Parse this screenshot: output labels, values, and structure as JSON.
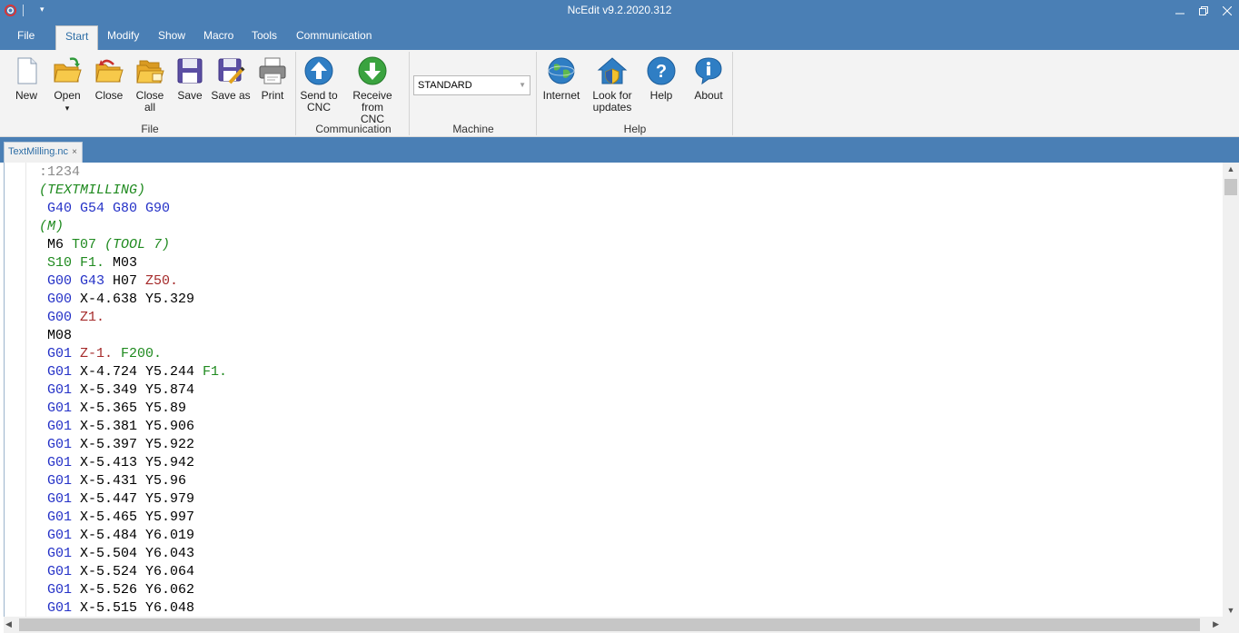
{
  "window": {
    "title": "NcEdit v9.2.2020.312",
    "qa_arrow": "▾",
    "minimize": "minimize",
    "restore": "restore",
    "close": "close"
  },
  "menu": {
    "tabs": [
      "File",
      "Start",
      "Modify",
      "Show",
      "Macro",
      "Tools",
      "Communication"
    ],
    "active": "Start"
  },
  "ribbon": {
    "file_group": {
      "label": "File",
      "buttons": {
        "new": "New",
        "open": "Open",
        "open_arrow": "▾",
        "close": "Close",
        "close_all": "Close all",
        "save": "Save",
        "save_as": "Save as",
        "print": "Print"
      }
    },
    "communication_group": {
      "label": "Communication",
      "send_line1": "Send to",
      "send_line2": "CNC",
      "receive_line1": "Receive from",
      "receive_line2": "CNC"
    },
    "machine_group": {
      "label": "Machine",
      "selected": "STANDARD"
    },
    "help_group": {
      "label": "Help",
      "internet": "Internet",
      "updates_line1": "Look for",
      "updates_line2": "updates",
      "help": "Help",
      "about": "About"
    }
  },
  "document": {
    "tab_name": "TextMilling.nc",
    "tab_close": "×"
  },
  "code_lines": [
    [
      {
        "t": ":1234",
        "k": "n"
      }
    ],
    [
      {
        "t": "(TEXTMILLING)",
        "k": "c"
      }
    ],
    [
      {
        "t": " G40 G54 G80 G90",
        "k": "g"
      }
    ],
    [
      {
        "t": "(M)",
        "k": "c"
      }
    ],
    [
      {
        "t": " M6 ",
        "k": "t"
      },
      {
        "t": "T07 ",
        "k": "f"
      },
      {
        "t": "(TOOL 7)",
        "k": "c"
      }
    ],
    [
      {
        "t": " S10 F1. ",
        "k": "f"
      },
      {
        "t": "M03",
        "k": "t"
      }
    ],
    [
      {
        "t": " G00 G43 ",
        "k": "g"
      },
      {
        "t": "H07 ",
        "k": "t"
      },
      {
        "t": "Z50.",
        "k": "z"
      }
    ],
    [
      {
        "t": " G00 ",
        "k": "g"
      },
      {
        "t": "X-4.638 Y5.329",
        "k": "t"
      }
    ],
    [
      {
        "t": " G00 ",
        "k": "g"
      },
      {
        "t": "Z1.",
        "k": "z"
      }
    ],
    [
      {
        "t": " M08",
        "k": "t"
      }
    ],
    [
      {
        "t": " G01 ",
        "k": "g"
      },
      {
        "t": "Z-1. ",
        "k": "z"
      },
      {
        "t": "F200.",
        "k": "f"
      }
    ],
    [
      {
        "t": " G01 ",
        "k": "g"
      },
      {
        "t": "X-4.724 Y5.244 ",
        "k": "t"
      },
      {
        "t": "F1.",
        "k": "f"
      }
    ],
    [
      {
        "t": " G01 ",
        "k": "g"
      },
      {
        "t": "X-5.349 Y5.874",
        "k": "t"
      }
    ],
    [
      {
        "t": " G01 ",
        "k": "g"
      },
      {
        "t": "X-5.365 Y5.89",
        "k": "t"
      }
    ],
    [
      {
        "t": " G01 ",
        "k": "g"
      },
      {
        "t": "X-5.381 Y5.906",
        "k": "t"
      }
    ],
    [
      {
        "t": " G01 ",
        "k": "g"
      },
      {
        "t": "X-5.397 Y5.922",
        "k": "t"
      }
    ],
    [
      {
        "t": " G01 ",
        "k": "g"
      },
      {
        "t": "X-5.413 Y5.942",
        "k": "t"
      }
    ],
    [
      {
        "t": " G01 ",
        "k": "g"
      },
      {
        "t": "X-5.431 Y5.96",
        "k": "t"
      }
    ],
    [
      {
        "t": " G01 ",
        "k": "g"
      },
      {
        "t": "X-5.447 Y5.979",
        "k": "t"
      }
    ],
    [
      {
        "t": " G01 ",
        "k": "g"
      },
      {
        "t": "X-5.465 Y5.997",
        "k": "t"
      }
    ],
    [
      {
        "t": " G01 ",
        "k": "g"
      },
      {
        "t": "X-5.484 Y6.019",
        "k": "t"
      }
    ],
    [
      {
        "t": " G01 ",
        "k": "g"
      },
      {
        "t": "X-5.504 Y6.043",
        "k": "t"
      }
    ],
    [
      {
        "t": " G01 ",
        "k": "g"
      },
      {
        "t": "X-5.524 Y6.064",
        "k": "t"
      }
    ],
    [
      {
        "t": " G01 ",
        "k": "g"
      },
      {
        "t": "X-5.526 Y6.062",
        "k": "t"
      }
    ],
    [
      {
        "t": " G01 ",
        "k": "g"
      },
      {
        "t": "X-5.515 Y6.048",
        "k": "t"
      }
    ]
  ],
  "colors": {
    "title_bar": "#4a7fb5",
    "ribbon_bg": "#f3f3f3",
    "gcode": "#2431c7",
    "comment": "#1f8a1f",
    "zvalue": "#a52a2a"
  },
  "icons": {
    "app": "ncedit-logo-icon",
    "new": "new-file-icon",
    "open": "open-folder-icon",
    "close": "close-folder-icon",
    "close_all": "close-all-folders-icon",
    "save": "floppy-icon",
    "save_as": "floppy-pencil-icon",
    "print": "printer-icon",
    "send": "upload-arrow-icon",
    "receive": "download-arrow-icon",
    "internet": "globe-icon",
    "updates": "house-shield-icon",
    "help": "question-icon",
    "about": "info-icon"
  }
}
